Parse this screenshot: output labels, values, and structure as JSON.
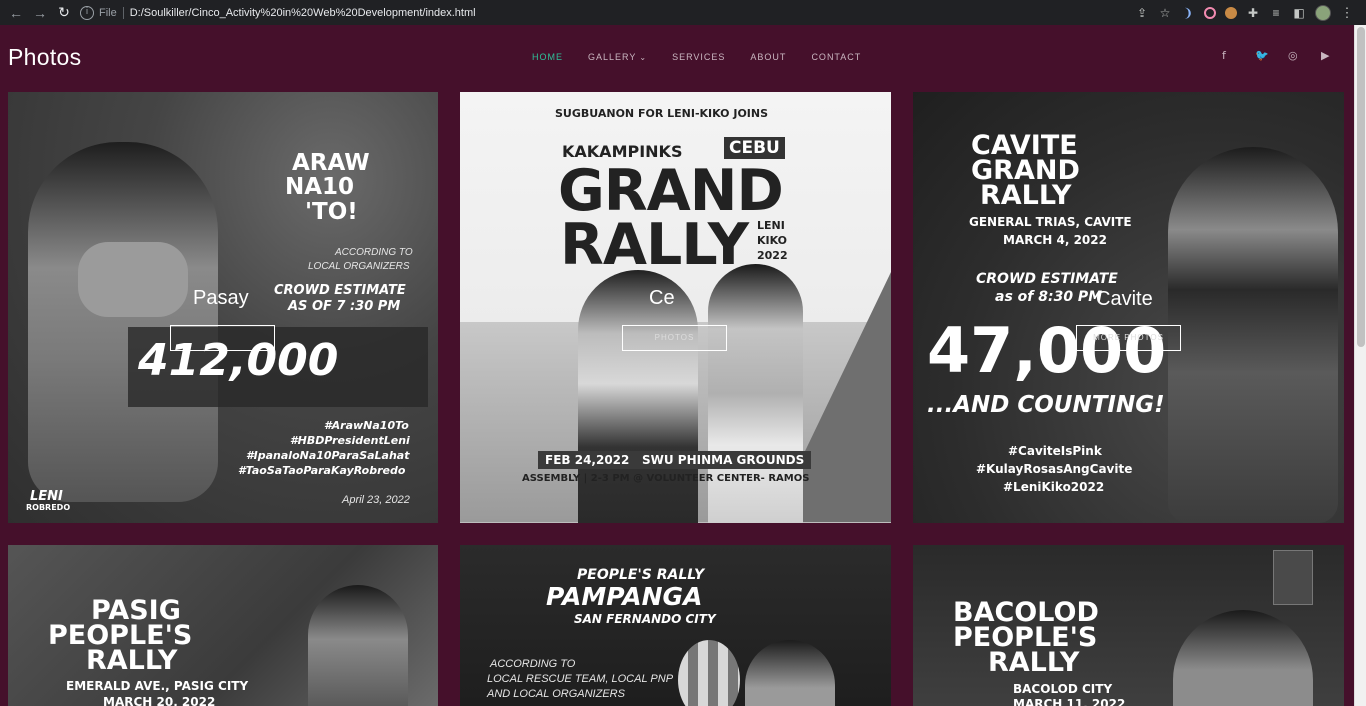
{
  "browser": {
    "file_label": "File",
    "url": "D:/Soulkiller/Cinco_Activity%20in%20Web%20Development/index.html"
  },
  "site": {
    "brand": "Photos",
    "menu": [
      {
        "label": "HOME",
        "active": true
      },
      {
        "label": "GALLERY",
        "dropdown": true
      },
      {
        "label": "SERVICES"
      },
      {
        "label": "ABOUT"
      },
      {
        "label": "CONTACT"
      }
    ],
    "socials": [
      "facebook-icon",
      "twitter-icon",
      "instagram-icon",
      "youtube-icon"
    ]
  },
  "cards": [
    {
      "overlay_title": "Pasay",
      "overlay_button": "",
      "poster": {
        "line1": "ARAW",
        "line2": "NA10",
        "line3": "'TO!",
        "according": "ACCORDING TO",
        "organizers": "LOCAL ORGANIZERS",
        "crowd1": "CROWD ESTIMATE",
        "crowd2": "AS OF  7 :30  PM",
        "number": "412,000",
        "tags": [
          "#ArawNa10To",
          "#HBDPresidentLeni",
          "#IpanaloNa10ParaSaLahat",
          "#TaoSaTaoParaKayRobredo"
        ],
        "date": "April 23, 2022",
        "logo": "LENI",
        "logo_sub": "ROBREDO"
      }
    },
    {
      "overlay_title": "Ce",
      "overlay_button": "PHOTOS",
      "poster": {
        "top": "SUGBUANON FOR LENI-KIKO JOINS",
        "kakampinks": "KAKAMPINKS",
        "city": "CEBU",
        "grand": "GRAND",
        "rally": "RALLY",
        "leni": "LENI",
        "kiko": "KIKO",
        "year": "2022",
        "date": "FEB 24,2022",
        "venue": "SWU PHINMA GROUNDS",
        "assembly": "ASSEMBLY | 2-3 PM @ VOLUNTEER CENTER- RAMOS"
      }
    },
    {
      "overlay_title": "Cavite",
      "overlay_button": "MORE PHOTOS",
      "poster": {
        "line1": "CAVITE",
        "line2": "GRAND",
        "line3": "RALLY",
        "place": "GENERAL TRIAS, CAVITE",
        "date": "MARCH 4, 2022",
        "crowd1": "CROWD ESTIMATE",
        "crowd2": "as of 8:30 PM",
        "number": "47,000",
        "counting": "...AND COUNTING!",
        "tags": [
          "#CaviteIsPink",
          "#KulayRosasAngCavite",
          "#LeniKiko2022"
        ]
      }
    },
    {
      "poster": {
        "line1": "PASIG",
        "line2": "PEOPLE'S",
        "line3": "RALLY",
        "place": "EMERALD AVE., PASIG CITY",
        "date": "MARCH 20, 2022"
      }
    },
    {
      "poster": {
        "line1": "PEOPLE'S RALLY",
        "line2": "PAMPANGA",
        "line3": "SAN FERNANDO CITY",
        "note1": "ACCORDING TO",
        "note2": "LOCAL RESCUE TEAM, LOCAL PNP",
        "note3": "AND LOCAL ORGANIZERS"
      }
    },
    {
      "poster": {
        "line1": "BACOLOD",
        "line2": "PEOPLE'S",
        "line3": "RALLY",
        "place": "BACOLOD CITY",
        "date": "MARCH 11, 2022"
      }
    }
  ]
}
